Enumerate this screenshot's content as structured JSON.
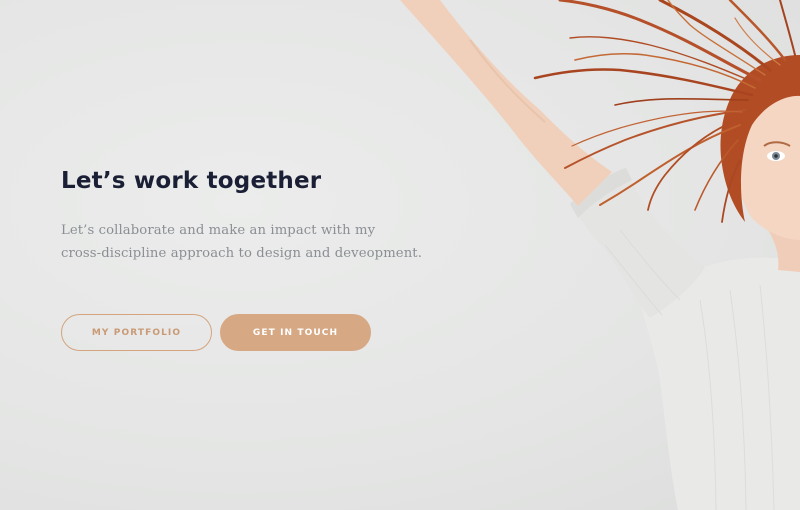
{
  "hero": {
    "headline": "Let’s work together",
    "intro_line_1": "Let’s collaborate and make an impact with my",
    "intro_line_2": "cross-discipline approach to design and deveopment.",
    "buttons": {
      "portfolio_label": "MY PORTFOLIO",
      "contact_label": "GET IN TOUCH"
    }
  },
  "colors": {
    "background": "#e6e7e6",
    "headline": "#1b1f35",
    "body_text": "#8b8f94",
    "accent": "#d6a884",
    "hair": "#b04a22",
    "skin": "#f2d2bd",
    "sweater": "#e9e9e8"
  },
  "image": {
    "subject": "woman-with-red-hair-raising-arm"
  }
}
